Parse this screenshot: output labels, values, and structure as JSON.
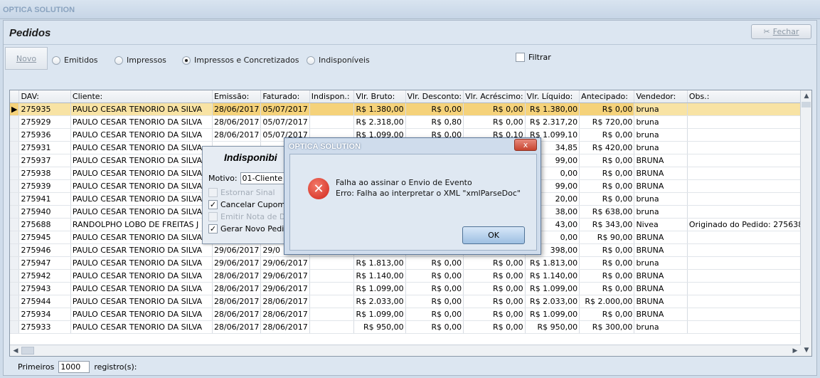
{
  "app": {
    "title": "OPTICA SOLUTION"
  },
  "page": {
    "title": "Pedidos",
    "close_label": "Fechar"
  },
  "toolbar": {
    "new_label": "Novo",
    "filters": [
      {
        "label": "Emitidos",
        "selected": false
      },
      {
        "label": "Impressos",
        "selected": false
      },
      {
        "label": "Impressos e Concretizados",
        "selected": true
      },
      {
        "label": "Indisponíveis",
        "selected": false
      }
    ],
    "filter_check_label": "Filtrar"
  },
  "grid": {
    "columns": [
      "DAV:",
      "Cliente:",
      "Emissão:",
      "Faturado:",
      "Indispon.:",
      "Vlr. Bruto:",
      "Vlr. Desconto:",
      "Vlr. Acréscimo:",
      "Vlr. Líquido:",
      "Antecipado:",
      "Vendedor:",
      "Obs.:"
    ],
    "rows": [
      [
        "275935",
        "PAULO CESAR TENORIO DA SILVA",
        "28/06/2017",
        "05/07/2017",
        "",
        "R$ 1.380,00",
        "R$ 0,00",
        "R$ 0,00",
        "R$ 1.380,00",
        "R$ 0,00",
        "bruna",
        ""
      ],
      [
        "275929",
        "PAULO CESAR TENORIO DA SILVA",
        "28/06/2017",
        "05/07/2017",
        "",
        "R$ 2.318,00",
        "R$ 0,80",
        "R$ 0,00",
        "R$ 2.317,20",
        "R$ 720,00",
        "bruna",
        ""
      ],
      [
        "275936",
        "PAULO CESAR TENORIO DA SILVA",
        "28/06/2017",
        "05/07/2017",
        "",
        "R$ 1.099,00",
        "R$ 0,00",
        "R$ 0,10",
        "R$ 1.099,10",
        "R$ 0,00",
        "bruna",
        ""
      ],
      [
        "275931",
        "PAULO CESAR TENORIO DA SILVA",
        "",
        "",
        "",
        "",
        "",
        "",
        "34,85",
        "R$ 420,00",
        "bruna",
        ""
      ],
      [
        "275937",
        "PAULO CESAR TENORIO DA SILVA",
        "",
        "",
        "",
        "",
        "",
        "",
        "99,00",
        "R$ 0,00",
        "BRUNA",
        ""
      ],
      [
        "275938",
        "PAULO CESAR TENORIO DA SILVA",
        "",
        "",
        "",
        "",
        "",
        "",
        "0,00",
        "R$ 0,00",
        "BRUNA",
        ""
      ],
      [
        "275939",
        "PAULO CESAR TENORIO DA SILVA",
        "",
        "",
        "",
        "",
        "",
        "",
        "99,00",
        "R$ 0,00",
        "BRUNA",
        ""
      ],
      [
        "275941",
        "PAULO CESAR TENORIO DA SILVA",
        "",
        "",
        "",
        "",
        "",
        "",
        "20,00",
        "R$ 0,00",
        "bruna",
        ""
      ],
      [
        "275940",
        "PAULO CESAR TENORIO DA SILVA",
        "",
        "",
        "",
        "",
        "",
        "",
        "38,00",
        "R$ 638,00",
        "bruna",
        ""
      ],
      [
        "275688",
        "RANDOLPHO LOBO DE FREITAS J",
        "",
        "",
        "",
        "",
        "",
        "",
        "43,00",
        "R$ 343,00",
        "Nivea",
        "Originado do Pedido: 275638"
      ],
      [
        "275945",
        "PAULO CESAR TENORIO DA SILVA",
        "",
        "",
        "",
        "",
        "",
        "",
        "0,00",
        "R$ 90,00",
        "BRUNA",
        ""
      ],
      [
        "275946",
        "PAULO CESAR TENORIO DA SILVA",
        "29/06/2017",
        "29/0",
        "",
        "",
        "",
        "",
        "398,00",
        "R$ 0,00",
        "BRUNA",
        ""
      ],
      [
        "275947",
        "PAULO CESAR TENORIO DA SILVA",
        "29/06/2017",
        "29/06/2017",
        "",
        "R$ 1.813,00",
        "R$ 0,00",
        "R$ 0,00",
        "R$ 1.813,00",
        "R$ 0,00",
        "bruna",
        ""
      ],
      [
        "275942",
        "PAULO CESAR TENORIO DA SILVA",
        "28/06/2017",
        "29/06/2017",
        "",
        "R$ 1.140,00",
        "R$ 0,00",
        "R$ 0,00",
        "R$ 1.140,00",
        "R$ 0,00",
        "BRUNA",
        ""
      ],
      [
        "275943",
        "PAULO CESAR TENORIO DA SILVA",
        "28/06/2017",
        "29/06/2017",
        "",
        "R$ 1.099,00",
        "R$ 0,00",
        "R$ 0,00",
        "R$ 1.099,00",
        "R$ 0,00",
        "BRUNA",
        ""
      ],
      [
        "275944",
        "PAULO CESAR TENORIO DA SILVA",
        "28/06/2017",
        "28/06/2017",
        "",
        "R$ 2.033,00",
        "R$ 0,00",
        "R$ 0,00",
        "R$ 2.033,00",
        "R$ 2.000,00",
        "BRUNA",
        ""
      ],
      [
        "275934",
        "PAULO CESAR TENORIO DA SILVA",
        "28/06/2017",
        "28/06/2017",
        "",
        "R$ 1.099,00",
        "R$ 0,00",
        "R$ 0,00",
        "R$ 1.099,00",
        "R$ 0,00",
        "BRUNA",
        ""
      ],
      [
        "275933",
        "PAULO CESAR TENORIO DA SILVA",
        "28/06/2017",
        "28/06/2017",
        "",
        "R$ 950,00",
        "R$ 0,00",
        "R$ 0,00",
        "R$ 950,00",
        "R$ 300,00",
        "bruna",
        ""
      ]
    ]
  },
  "footer": {
    "label": "Primeiros",
    "value": "1000",
    "suffix": "registro(s):"
  },
  "indisponibilidade_dialog": {
    "title": "Indisponibi",
    "motivo_label": "Motivo:",
    "motivo_value": "01-Cliente Er",
    "options": [
      {
        "label": "Estornar Sinal",
        "checked": false,
        "enabled": false
      },
      {
        "label": "Cancelar Cupom",
        "checked": true,
        "enabled": true
      },
      {
        "label": "Emitir Nota de De",
        "checked": false,
        "enabled": false
      },
      {
        "label": "Gerar Novo Pedido",
        "checked": true,
        "enabled": true
      }
    ]
  },
  "message_dialog": {
    "title": "OPTICA SOLUTION",
    "close_icon": "x",
    "line1": "Falha ao assinar o Envio de Evento",
    "line2": "Erro: Falha ao interpretar o XML \"xmlParseDoc\"",
    "ok_label": "OK"
  }
}
